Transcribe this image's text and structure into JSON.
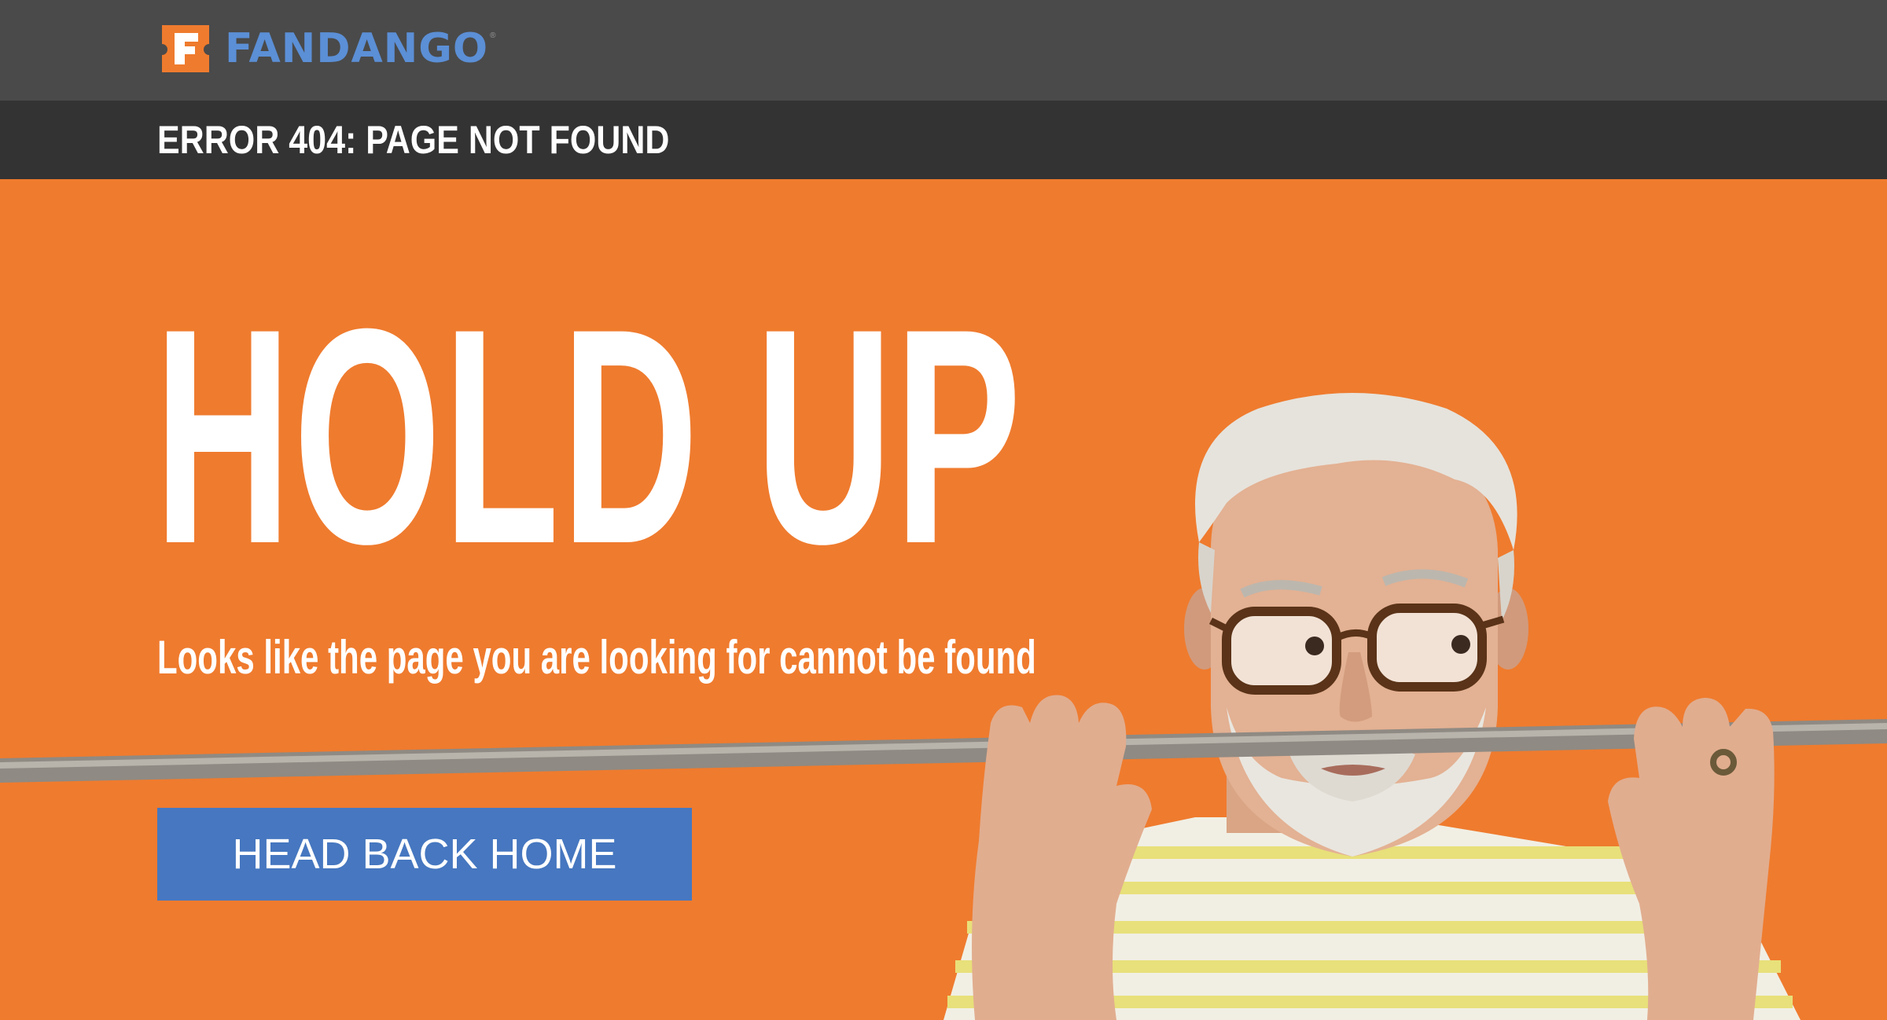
{
  "header": {
    "brand": "FANDANGO",
    "brand_mark": "fandango-ticket-logo",
    "registered": "®"
  },
  "error_bar": {
    "text": "ERROR 404: PAGE NOT FOUND"
  },
  "hero": {
    "headline": "HOLD UP",
    "subtext": "Looks like the page you are looking for cannot be found",
    "button_label": "HEAD BACK HOME",
    "image": "man-biting-metal-bar"
  },
  "colors": {
    "topbar": "#4a4a4a",
    "errorbar": "#333333",
    "background": "#ef7b2e",
    "brand_blue": "#5b8fd6",
    "button": "#4677c0",
    "logo_orange": "#ef7b2e"
  }
}
